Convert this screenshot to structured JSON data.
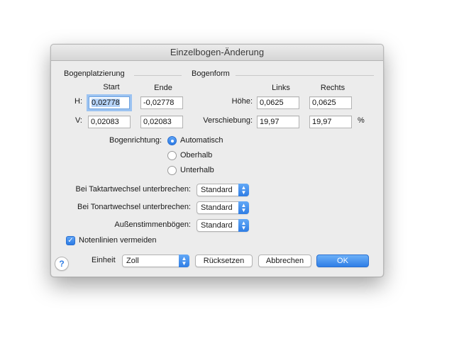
{
  "window": {
    "title": "Einzelbogen-Änderung"
  },
  "placement": {
    "group_label": "Bogenplatzierung",
    "col_start": "Start",
    "col_end": "Ende",
    "row_h_label": "H:",
    "row_v_label": "V:",
    "h_start": "0,02778",
    "h_end": "-0,02778",
    "v_start": "0,02083",
    "v_end": "0,02083"
  },
  "shape": {
    "group_label": "Bogenform",
    "col_left": "Links",
    "col_right": "Rechts",
    "row_height_label": "Höhe:",
    "row_shift_label": "Verschiebung:",
    "height_left": "0,0625",
    "height_right": "0,0625",
    "shift_left": "19,97",
    "shift_right": "19,97",
    "percent": "%"
  },
  "direction": {
    "label": "Bogenrichtung:",
    "options": [
      {
        "label": "Automatisch",
        "selected": true
      },
      {
        "label": "Oberhalb",
        "selected": false
      },
      {
        "label": "Unterhalb",
        "selected": false
      }
    ]
  },
  "breaks": {
    "time_sig_label": "Bei Taktartwechsel unterbrechen:",
    "time_sig_value": "Standard",
    "key_sig_label": "Bei Tonartwechsel unterbrechen:",
    "key_sig_value": "Standard",
    "outer_label": "Außenstimmenbögen:",
    "outer_value": "Standard"
  },
  "avoid_staff": {
    "label": "Notenlinien vermeiden",
    "checked": true
  },
  "footer": {
    "help": "?",
    "unit_label": "Einheit",
    "unit_value": "Zoll",
    "reset": "Rücksetzen",
    "cancel": "Abbrechen",
    "ok": "OK"
  },
  "colors": {
    "accent": "#2f7de4",
    "dialog_bg": "#ececec"
  }
}
